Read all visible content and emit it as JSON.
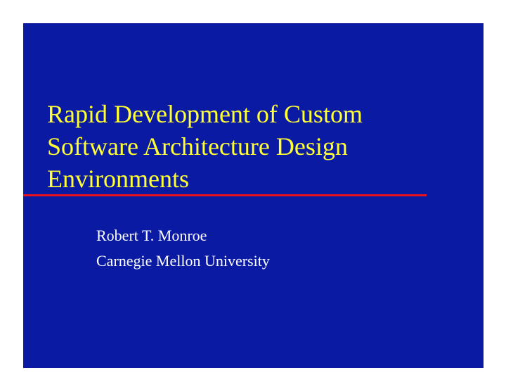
{
  "slide": {
    "title_lines": [
      "Rapid Development of Custom",
      "Software Architecture Design",
      "Environments"
    ],
    "author": "Robert T. Monroe",
    "affiliation": "Carnegie Mellon University",
    "colors": {
      "background": "#0a1aa3",
      "title": "#ffff33",
      "divider": "#e8121f",
      "subtitle": "#ffffff"
    }
  }
}
